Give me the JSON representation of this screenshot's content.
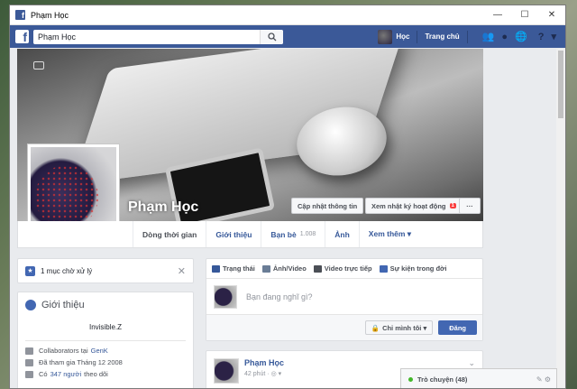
{
  "window": {
    "title": "Phạm Học",
    "minimize": "—",
    "maximize": "☐",
    "close": "✕"
  },
  "topbar": {
    "logo": "f",
    "search_value": "Phạm Học",
    "search_icon": "search-icon",
    "user_name": "Học",
    "home_label": "Trang chủ"
  },
  "profile": {
    "name": "Phạm Học",
    "update_info": "Cập nhật thông tin",
    "activity_log": "Xem nhật ký hoạt động",
    "activity_badge": "1",
    "more": "···"
  },
  "tabs": [
    {
      "label": "Dòng thời gian"
    },
    {
      "label": "Giới thiệu"
    },
    {
      "label": "Bạn bè",
      "count": "1.008"
    },
    {
      "label": "Ảnh"
    },
    {
      "label": "Xem thêm ▾"
    }
  ],
  "pending": {
    "text": "1 mục chờ xử lý",
    "close": "✕"
  },
  "intro": {
    "title": "Giới thiệu",
    "bio": "Invisible.Z",
    "work_prefix": "Collaborators tại",
    "work_place": "GenK",
    "joined": "Đã tham gia Tháng 12 2008",
    "followers_prefix": "Có",
    "followers_count": "347 người",
    "followers_suffix": "theo dõi"
  },
  "composer": {
    "tabs": [
      "Trạng thái",
      "Ảnh/Video",
      "Video trực tiếp",
      "Sự kiện trong đời"
    ],
    "placeholder": "Bạn đang nghĩ gì?",
    "privacy": "Chỉ mình tôi ▾",
    "post": "Đăng"
  },
  "post": {
    "author": "Phạm Học",
    "time": "42 phút · ◎ ▾",
    "chevron": "⌄"
  },
  "chat": {
    "label": "Trò chuyện (48)"
  },
  "colors": {
    "brand": "#3b5998",
    "button": "#4267b2",
    "link": "#365899"
  }
}
